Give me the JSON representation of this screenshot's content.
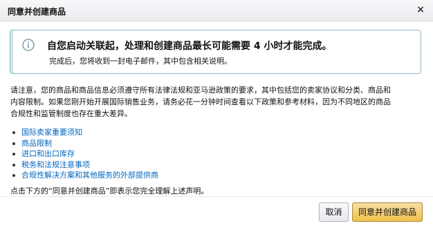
{
  "dialog": {
    "title": "同意并创建商品",
    "close_icon": "close-icon",
    "close_glyph": "×"
  },
  "info": {
    "icon": "info-icon",
    "title": "自您启动关联起，处理和创建商品最长可能需要 4 小时才能完成。",
    "subtitle": "完成后，您将收到一封电子邮件，其中包含相关说明。"
  },
  "notice": {
    "line1": "请注意，您的商品和商品信息必须遵守所有法律法规和亚马逊政策的要求，其中包括您的卖家协议和分类、商品和",
    "line2": "内容限制。如果您刚开始开展国际销售业务，请务必花一分钟时间查看以下政策和参考材料，因为不同地区的商品",
    "line3": "合规性和监管制度也存在重大差异。"
  },
  "links": [
    {
      "label": "国际卖家重要须知"
    },
    {
      "label": "商品限制"
    },
    {
      "label": "进口和出口库存"
    },
    {
      "label": "税务和法规注意事项"
    },
    {
      "label": "合规性解决方案和其他服务的外部提供商"
    }
  ],
  "confirm_text": "点击下方的“同意并创建商品”即表示您完全理解上述声明。",
  "buttons": {
    "cancel": "取消",
    "agree": "同意并创建商品"
  },
  "colors": {
    "link": "#0066c0",
    "info_border": "#8fbcc8",
    "primary_button": "#f0c14b"
  }
}
